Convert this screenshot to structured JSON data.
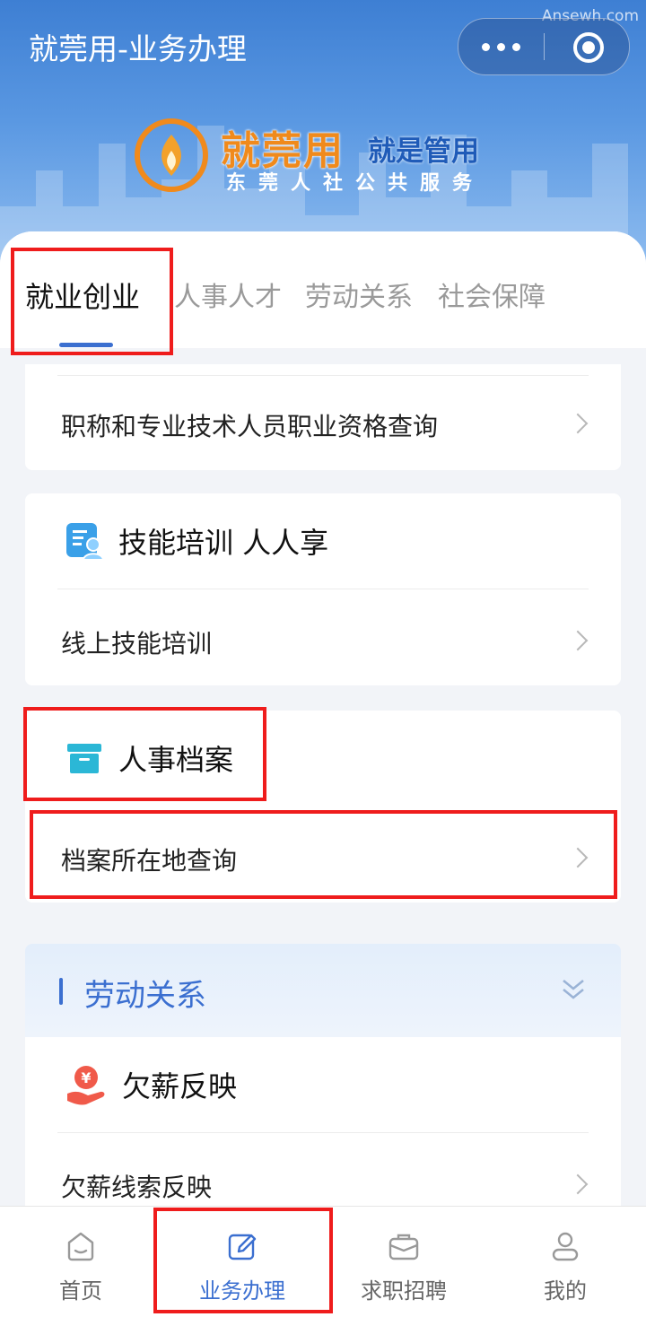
{
  "window": {
    "title": "就莞用-业务办理",
    "watermark": "Ansewh.com",
    "more_icon": "more-dots-icon",
    "close_icon": "target-close-icon"
  },
  "banner": {
    "brand": "就莞用",
    "slogan": "就是管用",
    "subtitle": "东莞人社公共服务"
  },
  "tabs": [
    {
      "label": "就业创业",
      "active": true
    },
    {
      "label": "人事人才",
      "active": false
    },
    {
      "label": "劳动关系",
      "active": false
    },
    {
      "label": "社会保障",
      "active": false
    }
  ],
  "content": {
    "card1": {
      "item": "职称和专业技术人员职业资格查询"
    },
    "card2": {
      "title": "技能培训 人人享",
      "icon": "training-person-icon",
      "item": "线上技能培训"
    },
    "card3": {
      "title": "人事档案",
      "icon": "archive-box-icon",
      "item": "档案所在地查询"
    },
    "section": {
      "title": "劳动关系",
      "icon": "double-chevron-down-icon"
    },
    "card4": {
      "title": "欠薪反映",
      "icon": "yuan-hand-icon",
      "item": "欠薪线索反映"
    }
  },
  "tabbar": [
    {
      "label": "首页",
      "icon": "home-icon",
      "active": false
    },
    {
      "label": "业务办理",
      "icon": "edit-icon",
      "active": true
    },
    {
      "label": "求职招聘",
      "icon": "briefcase-icon",
      "active": false
    },
    {
      "label": "我的",
      "icon": "user-icon",
      "active": false
    }
  ],
  "colors": {
    "accent": "#3b6fd0",
    "highlight": "#ef1c1c",
    "brand_orange": "#f08a1c"
  }
}
